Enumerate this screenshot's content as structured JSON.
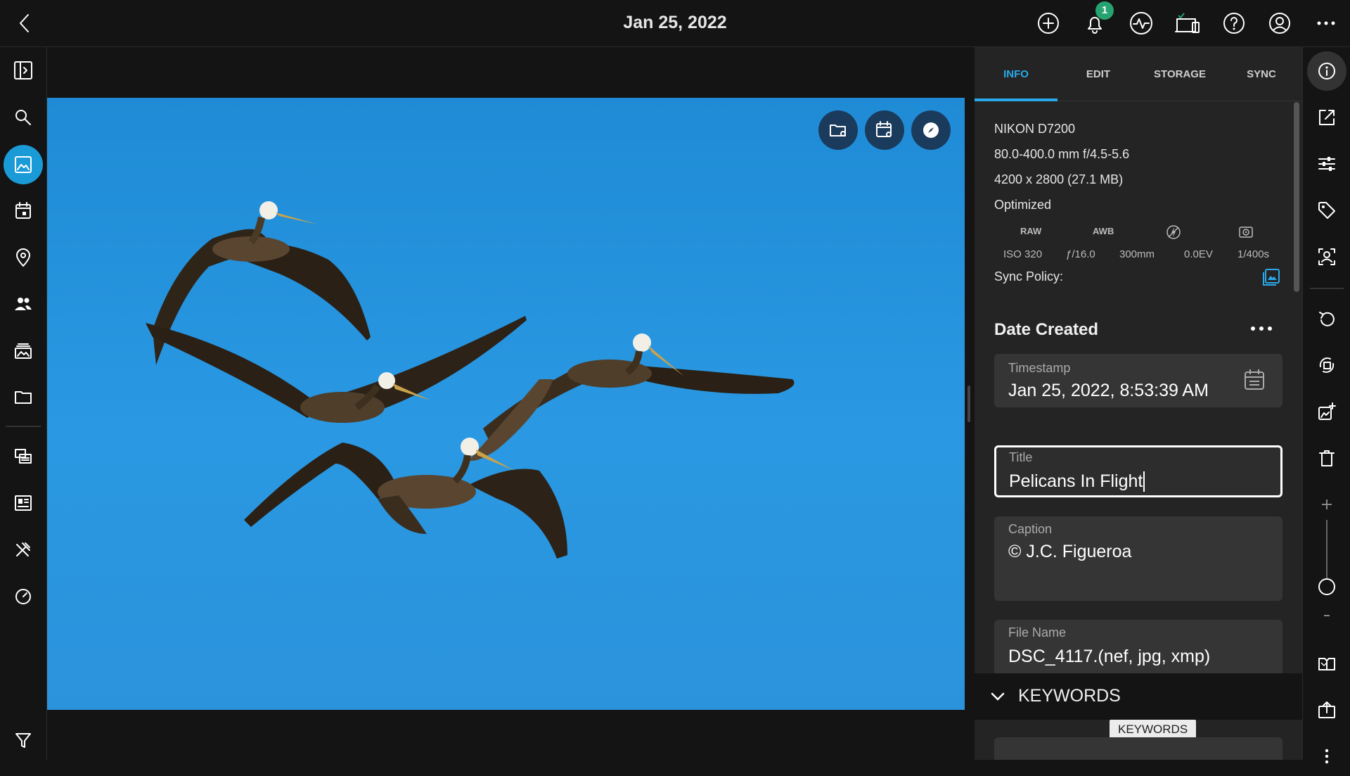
{
  "header": {
    "title": "Jan 25, 2022",
    "notification_count": "1",
    "icons": [
      "back-icon",
      "add-icon",
      "bell-icon",
      "activity-icon",
      "devices-icon",
      "help-icon",
      "account-icon",
      "more-icon"
    ]
  },
  "left_rail": {
    "icons": [
      "sidebar-toggle-icon",
      "search-icon",
      "photos-icon",
      "calendar-icon",
      "map-pin-icon",
      "people-icon",
      "albums-icon",
      "folder-icon",
      "duplicates-icon",
      "dashboard-icon",
      "tools-icon",
      "speed-icon",
      "filter-icon"
    ],
    "active": "photos-icon"
  },
  "viewer": {
    "overlay_icons": [
      "folder-reveal-icon",
      "calendar-reveal-icon",
      "compass-icon"
    ]
  },
  "panel": {
    "tabs": [
      {
        "label": "INFO",
        "active": true
      },
      {
        "label": "EDIT",
        "active": false
      },
      {
        "label": "STORAGE",
        "active": false
      },
      {
        "label": "SYNC",
        "active": false
      }
    ],
    "camera": "NIKON D7200",
    "lens": "80.0-400.0 mm f/4.5-5.6",
    "dimensions": "4200 x 2800 (27.1 MB)",
    "status": "Optimized",
    "exif_headers": {
      "raw": "RAW",
      "awb": "AWB"
    },
    "exif_values": {
      "iso": "ISO 320",
      "aperture": "ƒ/16.0",
      "focal": "300mm",
      "ev": "0.0EV",
      "shutter": "1/400s"
    },
    "sync_policy_label": "Sync Policy:",
    "date_created": {
      "heading": "Date Created",
      "timestamp_label": "Timestamp",
      "timestamp_value": "Jan 25, 2022, 8:53:39 AM"
    },
    "title_field": {
      "label": "Title",
      "value": "Pelicans In Flight"
    },
    "caption_field": {
      "label": "Caption",
      "value": "© J.C. Figueroa"
    },
    "filename_field": {
      "label": "File Name",
      "value": "DSC_4117.(nef, jpg, xmp)"
    },
    "keywords": {
      "heading": "KEYWORDS",
      "tooltip": "KEYWORDS"
    }
  },
  "right_rail": {
    "icons": [
      "info-icon",
      "open-external-icon",
      "adjustments-icon",
      "tag-icon",
      "face-icon",
      "rotate-icon",
      "transform-icon",
      "add-to-album-icon",
      "trash-icon",
      "zoom-in-icon",
      "zoom-out-icon",
      "compare-icon",
      "export-icon",
      "more-vertical-icon"
    ],
    "zoom_level": 0.0
  },
  "colors": {
    "accent": "#1a9bd8",
    "sky": "#2a98e2",
    "badge": "#27a372"
  }
}
